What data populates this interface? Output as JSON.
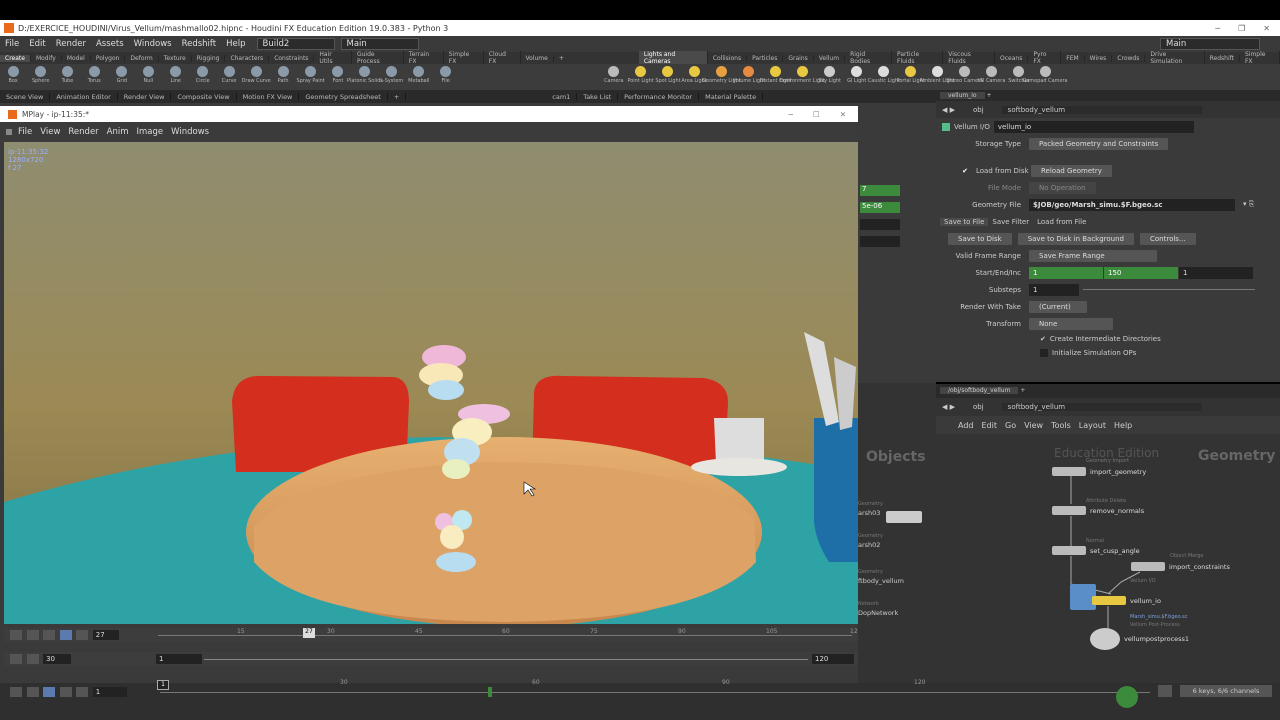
{
  "window": {
    "title": "D:/EXERCICE_HOUDINI/Virus_Vellum/mashmallo02.hipnc - Houdini FX Education Edition 19.0.383 - Python 3"
  },
  "menubar": {
    "items": [
      "File",
      "Edit",
      "Render",
      "Assets",
      "Windows",
      "Redshift",
      "Help"
    ],
    "build": "Build2",
    "desktop": "Main",
    "right_desktop": "Main"
  },
  "shelf_tabs_left": [
    "Create",
    "Modify",
    "Model",
    "Polygon",
    "Deform",
    "Texture",
    "Rigging",
    "Characters",
    "Constraints",
    "Hair Utils",
    "Guide Process",
    "Terrain FX",
    "Simple FX",
    "Cloud FX",
    "Volume"
  ],
  "shelf_tabs_right": [
    "Lights and Cameras",
    "Collisions",
    "Particles",
    "Grains",
    "Vellum",
    "Rigid Bodies",
    "Particle Fluids",
    "Viscous Fluids",
    "Oceans",
    "Pyro FX",
    "FEM",
    "Wires",
    "Crowds",
    "Drive Simulation",
    "Redshift",
    "Simple FX"
  ],
  "tools_left": [
    "Box",
    "Sphere",
    "Tube",
    "Torus",
    "Grid",
    "Null",
    "Line",
    "Circle",
    "Curve",
    "Draw Curve",
    "Path",
    "Spray Paint",
    "Font",
    "Platonic Solids",
    "L-System",
    "Metaball",
    "File"
  ],
  "tools_right": [
    "Camera",
    "Point Light",
    "Spot Light",
    "Area Light",
    "Geometry Light",
    "Volume Light",
    "Distant Light",
    "Environment Light",
    "Sky Light",
    "GI Light",
    "Caustic Light",
    "Portal Light",
    "Ambient Light",
    "Stereo Camera",
    "VR Camera",
    "Switcher",
    "Gamepad Camera"
  ],
  "pane_tabs": [
    "Scene View",
    "Animation Editor",
    "Render View",
    "Composite View",
    "Motion FX View",
    "Geometry Spreadsheet",
    "cam1",
    "Take List",
    "Performance Monitor",
    "Material Palette"
  ],
  "mplay": {
    "title": "MPlay - ip-11:35:*",
    "menu": [
      "File",
      "View",
      "Render",
      "Anim",
      "Image",
      "Windows"
    ],
    "info": [
      "ip-11:35:32",
      "1280x720",
      "f 27"
    ],
    "frame": "27",
    "fps": "30",
    "range_start": "1",
    "range_end": "120",
    "ticks": [
      "15",
      "27",
      "30",
      "45",
      "60",
      "75",
      "90",
      "105",
      "12"
    ]
  },
  "params": {
    "tab": "vellum_io",
    "path_obj": "obj",
    "path_node": "softbody_vellum",
    "node_type": "Vellum I/O",
    "node_name": "vellum_io",
    "storage_type_label": "Storage Type",
    "storage_type": "Packed Geometry and Constraints",
    "load_from_disk": "Load from Disk",
    "reload_geometry": "Reload Geometry",
    "file_mode_label": "File Mode",
    "file_mode": "No Operation",
    "geometry_file_label": "Geometry File",
    "geometry_file": "$JOB/geo/Marsh_simu.$F.bgeo.sc",
    "subtabs": [
      "Save to File",
      "Save Filter",
      "Load from File"
    ],
    "save_to_disk": "Save to Disk",
    "save_bg": "Save to Disk in Background",
    "controls": "Controls...",
    "valid_range_label": "Valid Frame Range",
    "valid_range": "Save Frame Range",
    "start_end_label": "Start/End/Inc",
    "start": "1",
    "end": "150",
    "inc": "1",
    "substeps_label": "Substeps",
    "substeps": "1",
    "render_take_label": "Render With Take",
    "render_take": "(Current)",
    "transform_label": "Transform",
    "transform": "None",
    "create_dirs": "Create Intermediate Directories",
    "init_sim": "Initialize Simulation OPs"
  },
  "middle_panel": {
    "values": [
      "7",
      "5e-06"
    ],
    "labels": [
      "Objects"
    ],
    "nodes": [
      "arsh03",
      "arsh02",
      "ftbody_vellum",
      "DopNetwork"
    ],
    "node_types": [
      "Geometry",
      "Geometry",
      "Geometry",
      "Network"
    ]
  },
  "network": {
    "tab": "/obj/softbody_vellum",
    "path_obj": "obj",
    "path_node": "softbody_vellum",
    "menu": [
      "Add",
      "Edit",
      "Go",
      "View",
      "Tools",
      "Layout",
      "Help"
    ],
    "watermark": "Education Edition",
    "context": "Geometry",
    "nodes": [
      {
        "name": "import_geometry",
        "type": "Geometry Import"
      },
      {
        "name": "remove_normals",
        "type": "Attribute Delete"
      },
      {
        "name": "set_cusp_angle",
        "type": "Normal"
      },
      {
        "name": "import_constraints",
        "type": "Object Merge"
      },
      {
        "name": "vellum_io",
        "type": "Vellum I/O",
        "sub": "Marsh_simu.$F.bgeo.sc"
      },
      {
        "name": "vellumpostprocess1",
        "type": "Vellum Post-Process"
      }
    ]
  },
  "global_timeline": {
    "frame": "1",
    "ticks": [
      "1",
      "30",
      "60",
      "90",
      "120"
    ],
    "keys": "6 keys, 6/6 channels"
  },
  "colors": {
    "accent_green": "#3c8a3c",
    "node_yellow": "#e8c840",
    "sky": "#9a8a5a",
    "floor": "#2fa5a8",
    "table": "#e0a060",
    "chair": "#d63020"
  }
}
